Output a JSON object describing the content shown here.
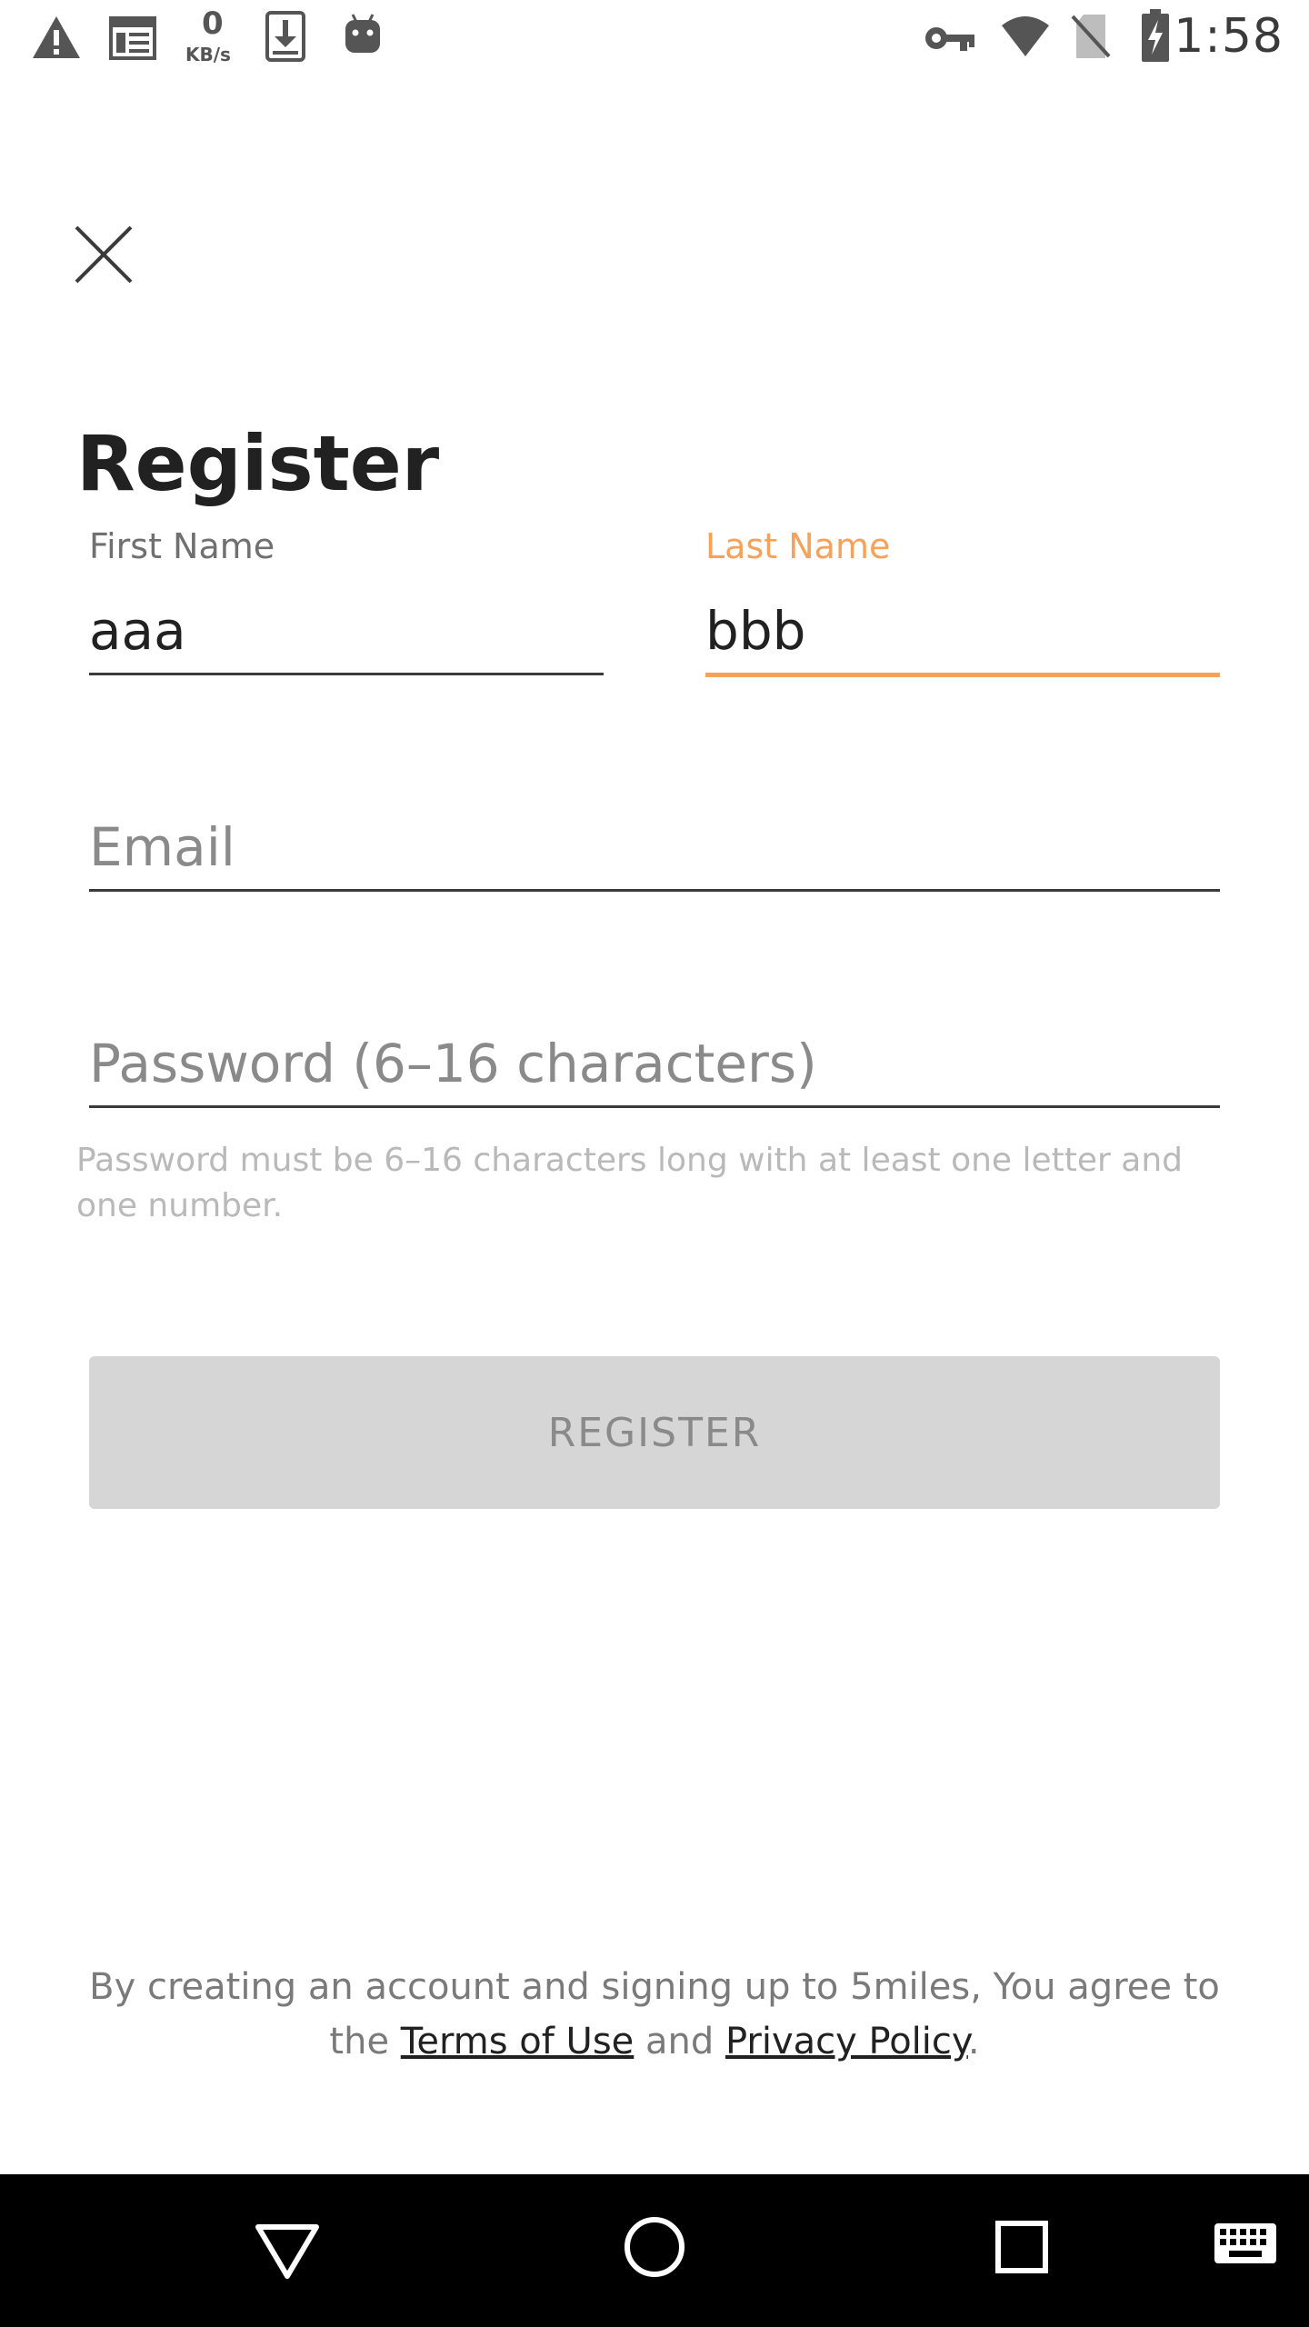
{
  "status_bar": {
    "time": "1:58",
    "speed_value": "0",
    "speed_unit": "KB/s",
    "icons": [
      "warning-icon",
      "news-icon",
      "network-speed-icon",
      "download-icon",
      "android-icon",
      "vpn-key-icon",
      "wifi-icon",
      "no-sim-icon",
      "battery-charging-icon"
    ]
  },
  "header": {
    "close_icon": "close-icon",
    "title": "Register"
  },
  "form": {
    "first_name": {
      "label": "First Name",
      "value": "aaa"
    },
    "last_name": {
      "label": "Last Name",
      "value": "bbb"
    },
    "email": {
      "placeholder": "Email",
      "value": ""
    },
    "password": {
      "placeholder": "Password (6–16 characters)",
      "value": ""
    },
    "password_helper": "Password must be 6–16 characters long with at least one letter and one number.",
    "register_label": "REGISTER"
  },
  "terms": {
    "prefix": "By creating an account and signing up to 5miles, You agree to the ",
    "terms_link": "Terms of Use",
    "middle": " and ",
    "privacy_link": "Privacy Policy",
    "suffix": "."
  },
  "nav_bar": {
    "icons": [
      "back-icon",
      "home-icon",
      "recents-icon",
      "keyboard-icon"
    ]
  },
  "colors": {
    "accent": "#f5a25d",
    "button_bg": "#d6d6d6",
    "button_text": "#8a8a8a",
    "helper_text": "#b9b9b9",
    "nav_bg": "#000000"
  }
}
